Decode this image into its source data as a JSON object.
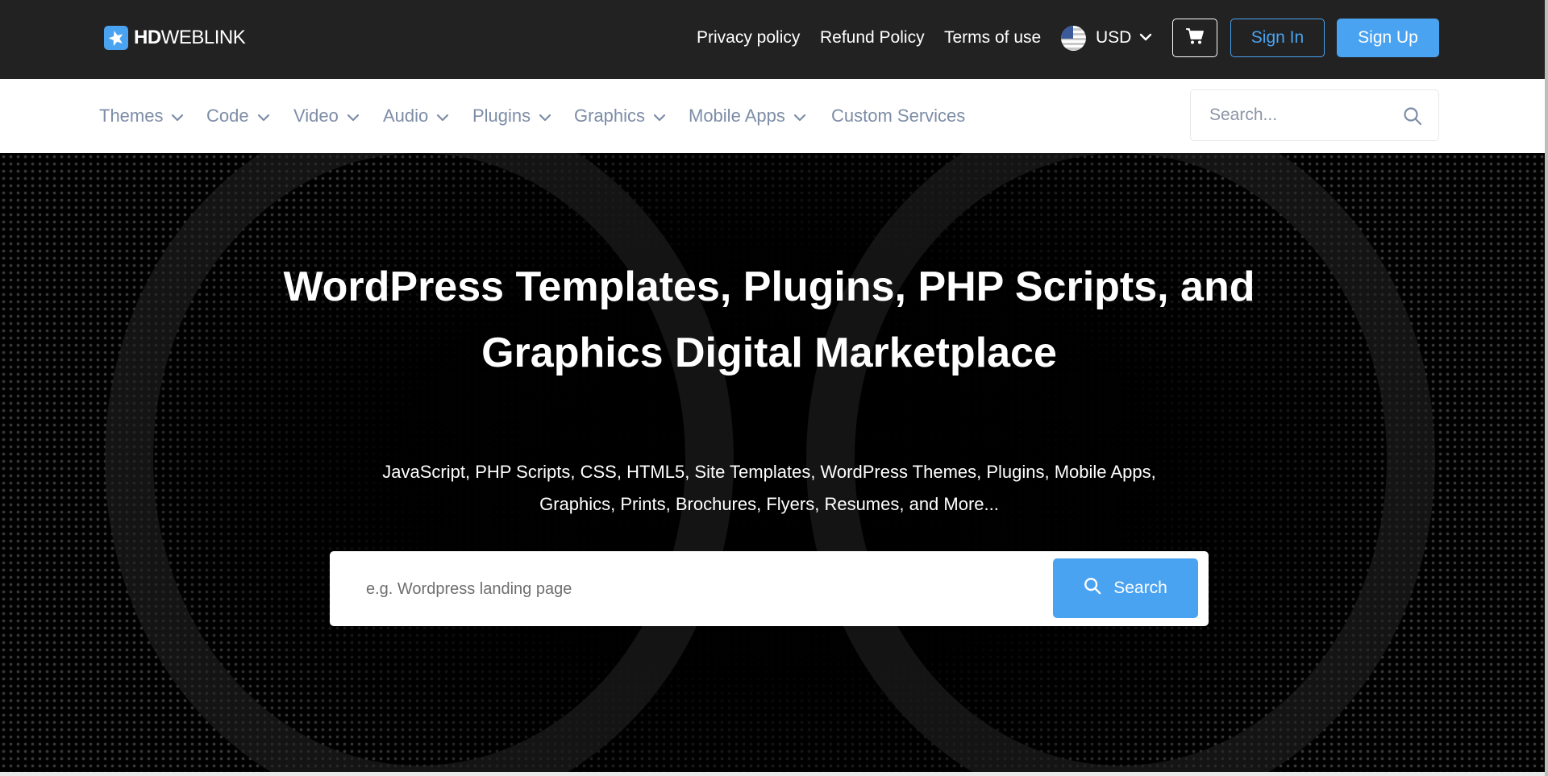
{
  "brand": {
    "logo_bold": "HD",
    "logo_rest": "WEBLINK",
    "accent_color": "#4aa3f0",
    "logo_icon": "star-icon"
  },
  "top_links": [
    {
      "label": "Privacy policy"
    },
    {
      "label": "Refund Policy"
    },
    {
      "label": "Terms of use"
    }
  ],
  "currency": {
    "flag_icon": "us-flag-icon",
    "selected": "USD"
  },
  "cart": {
    "icon": "cart-icon"
  },
  "auth": {
    "sign_in": "Sign In",
    "sign_up": "Sign Up"
  },
  "nav": {
    "items": [
      {
        "label": "Themes",
        "has_dropdown": true
      },
      {
        "label": "Code",
        "has_dropdown": true
      },
      {
        "label": "Video",
        "has_dropdown": true
      },
      {
        "label": "Audio",
        "has_dropdown": true
      },
      {
        "label": "Plugins",
        "has_dropdown": true
      },
      {
        "label": "Graphics",
        "has_dropdown": true
      },
      {
        "label": "Mobile Apps",
        "has_dropdown": true
      },
      {
        "label": "Custom Services",
        "has_dropdown": false
      }
    ],
    "search_placeholder": "Search...",
    "search_value": ""
  },
  "hero": {
    "title_line1": "WordPress Templates, Plugins, PHP Scripts, and",
    "title_line2": "Graphics Digital Marketplace",
    "subtitle_line1": "JavaScript, PHP Scripts, CSS, HTML5, Site Templates, WordPress Themes, Plugins, Mobile Apps,",
    "subtitle_line2": "Graphics, Prints, Brochures, Flyers, Resumes, and More...",
    "search_placeholder": "e.g. Wordpress landing page",
    "search_value": "",
    "search_button": "Search"
  }
}
